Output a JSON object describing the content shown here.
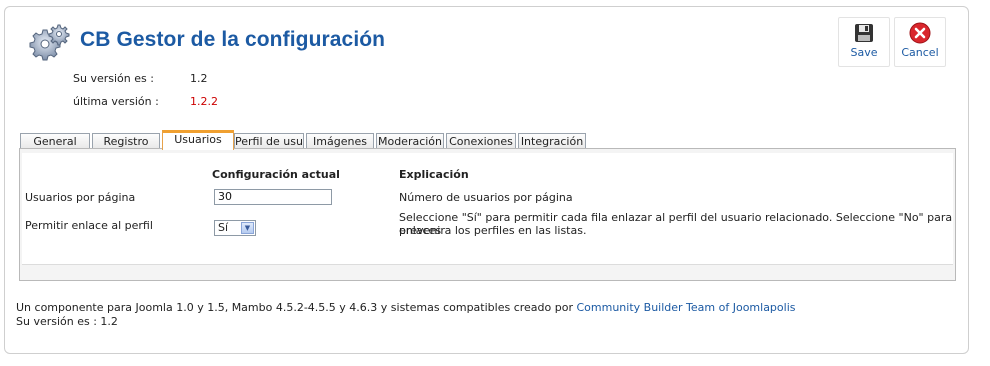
{
  "header": {
    "title": "CB Gestor de la configuración",
    "logo_icon": "gears-icon"
  },
  "toolbar": {
    "save_label": "Save",
    "save_icon": "floppy-disk-icon",
    "cancel_label": "Cancel",
    "cancel_icon": "red-x-circle-icon"
  },
  "version": {
    "current_label": "Su versión es :",
    "current_value": "1.2",
    "latest_label": "última versión :",
    "latest_value": "1.2.2",
    "latest_color": "#cc0000"
  },
  "tabs": [
    {
      "label": "General"
    },
    {
      "label": "Registro"
    },
    {
      "label": "Usuarios",
      "active": true
    },
    {
      "label": "Perfil de usuari"
    },
    {
      "label": "Imágenes"
    },
    {
      "label": "Moderación"
    },
    {
      "label": "Conexiones"
    },
    {
      "label": "Integración"
    }
  ],
  "table": {
    "col_current": "Configuración actual",
    "col_explanation": "Explicación",
    "rows": [
      {
        "label": "Usuarios por página",
        "value": "30",
        "explanation": "Número de usuarios por página"
      },
      {
        "label": "Permitir enlace al perfil",
        "value": "Sí",
        "explanation_line1": "Seleccione \"Sí\" para permitir cada fila enlazar al perfil del usuario relacionado. Seleccione \"No\" para prevenir",
        "explanation_line2": "enlaces a los perfiles en las listas."
      }
    ]
  },
  "footer": {
    "text": "Un componente para Joomla 1.0 y 1.5, Mambo 4.5.2-4.5.5 y 4.6.3 y sistemas compatibles creado por",
    "link": "Community Builder Team of Joomlapolis",
    "version_line": "Su versión es : 1.2"
  },
  "colors": {
    "accent": "#1c5aa3",
    "active_tab": "#f0a030"
  }
}
